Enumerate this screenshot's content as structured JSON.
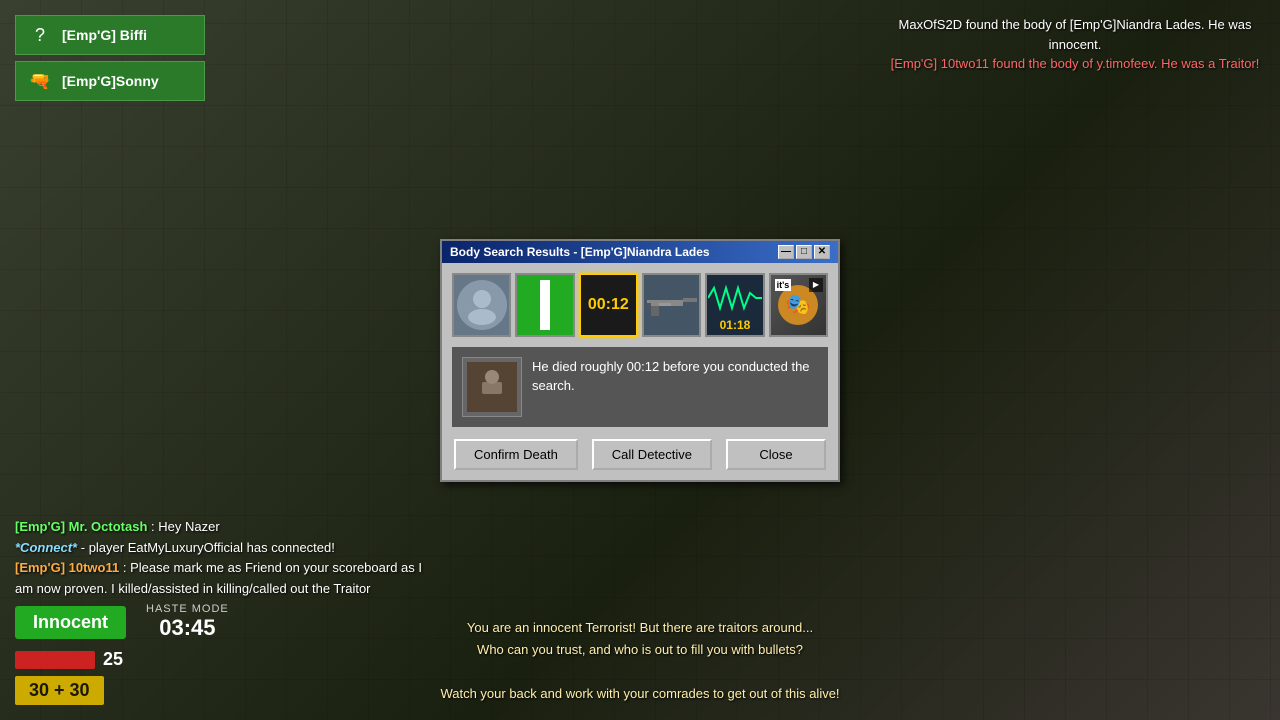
{
  "game": {
    "background": "dark industrial map"
  },
  "event_log": {
    "line1": "MaxOfS2D found the body of [Emp'G]Niandra Lades. He was innocent.",
    "line2": "[Emp'G] 10two11 found the body of y.timofeev. He was a Traitor!"
  },
  "players": [
    {
      "name": "[Emp'G] Biffi",
      "icon": "?"
    },
    {
      "name": "[Emp'G]Sonny",
      "icon": "🔫"
    }
  ],
  "chat": [
    {
      "name": "[Emp'G] Mr. Octotash",
      "name_type": "green",
      "text": ": Hey Nazer"
    },
    {
      "name": "*Connect*",
      "name_type": "connect",
      "text": " - player EatMyLuxuryOfficial has connected!"
    },
    {
      "name": "[Emp'G] 10two11",
      "name_type": "orange",
      "text": ": Please mark me as Friend on your scoreboard as I am now proven. I killed/assisted in killing/called out the Traitor"
    }
  ],
  "hud": {
    "role": "Innocent",
    "haste_label": "HASTE MODE",
    "haste_time": "03:45",
    "health": "25",
    "ammo": "30 + 30"
  },
  "bottom_message": {
    "line1": "You are an innocent Terrorist! But there are traitors around...",
    "line2": "Who can you trust, and who is out to fill you with bullets?",
    "line3": "",
    "line4": "Watch your back and work with your comrades to get out of this alive!"
  },
  "modal": {
    "title": "Body Search Results - [Emp'G]Niandra Lades",
    "icons": [
      {
        "type": "avatar",
        "label": "avatar"
      },
      {
        "type": "traitor",
        "label": "traitor bar"
      },
      {
        "type": "timer",
        "label": "00:12",
        "selected": true
      },
      {
        "type": "rifle",
        "label": "rifle"
      },
      {
        "type": "signal",
        "label": "01:18"
      },
      {
        "type": "masked",
        "label": "masked face"
      }
    ],
    "info_text": "He died roughly 00:12 before you conducted the search.",
    "buttons": {
      "confirm": "Confirm Death",
      "detective": "Call Detective",
      "close": "Close"
    },
    "titlebar_buttons": {
      "minimize": "—",
      "restore": "□",
      "close": "✕"
    }
  }
}
